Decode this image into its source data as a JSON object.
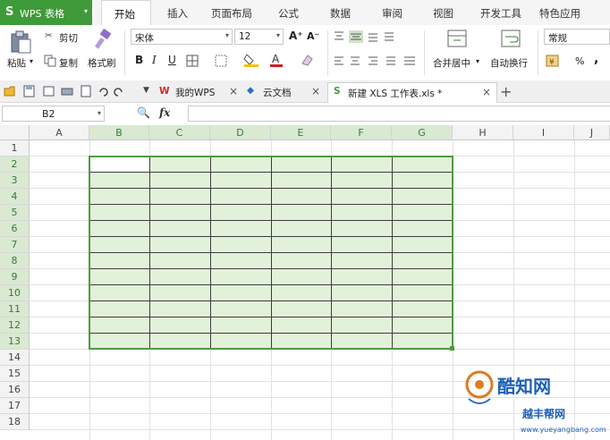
{
  "app": {
    "logo": "S",
    "name": "WPS 表格",
    "dropdown": "▾"
  },
  "menu": {
    "tabs": [
      "开始",
      "插入",
      "页面布局",
      "公式",
      "数据",
      "审阅",
      "视图",
      "开发工具",
      "特色应用"
    ],
    "active": "开始"
  },
  "ribbon": {
    "paste": "粘贴",
    "paste_arrow": "▾",
    "cut": "剪切",
    "copy": "复制",
    "format_painter": "格式刷",
    "font_name": "宋体",
    "font_size": "12",
    "grow": "A⁺",
    "shrink": "A⁻",
    "bold": "B",
    "italic": "I",
    "underline": "U",
    "merge_center": "合并居中",
    "merge_arrow": "▾",
    "wrap_text": "自动换行",
    "number_format": "常规",
    "percent": "%",
    "comma": ",",
    "dropdown": "▾"
  },
  "doc_tabs": [
    {
      "label": "我的WPS",
      "close": "×"
    },
    {
      "label": "云文档",
      "close": "×"
    },
    {
      "label": "新建 XLS 工作表.xls *",
      "close": "×"
    }
  ],
  "add_tab": "+",
  "formula_bar": {
    "name_box": "B2",
    "fx": "fx",
    "formula": ""
  },
  "grid": {
    "columns": [
      "A",
      "B",
      "C",
      "D",
      "E",
      "F",
      "G",
      "H",
      "I",
      "J"
    ],
    "rows": [
      "1",
      "2",
      "3",
      "4",
      "5",
      "6",
      "7",
      "8",
      "9",
      "10",
      "11",
      "12",
      "13",
      "14",
      "15",
      "16",
      "17",
      "18"
    ]
  },
  "watermark": {
    "title": "酷知网",
    "sub": "www.yueyangbang.com",
    "sub_title": "越丰帮网"
  },
  "colors": {
    "brand_green": "#3f9a3a",
    "selection_fill": "#e2f1d9",
    "selection_border": "#4f9a43"
  }
}
